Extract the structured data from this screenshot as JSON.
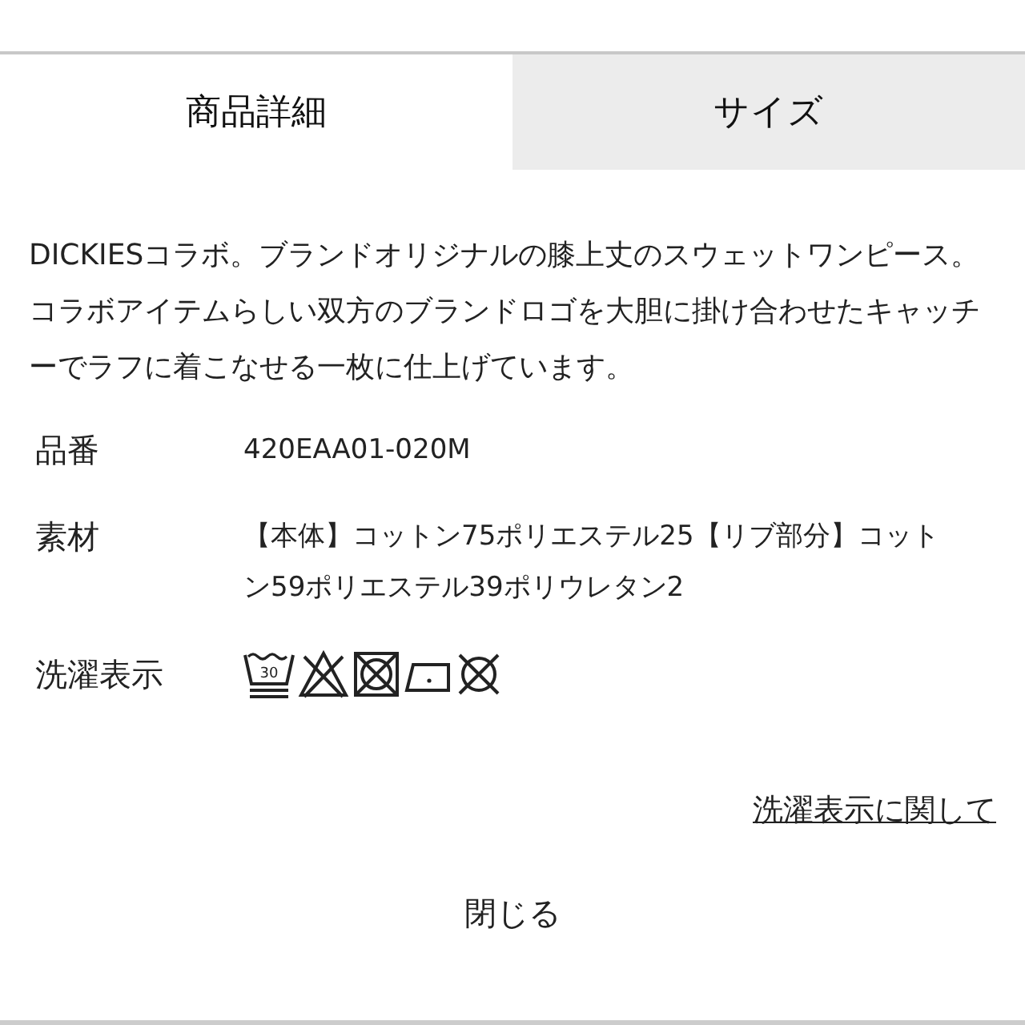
{
  "tabs": [
    {
      "label": "商品詳細",
      "selected": true
    },
    {
      "label": "サイズ",
      "selected": false
    }
  ],
  "description": "DICKIESコラボ。ブランドオリジナルの膝上丈のスウェットワンピース。コラボアイテムらしい双方のブランドロゴを大胆に掛け合わせたキャッチーでラフに着こなせる一枚に仕上げています。",
  "specs": [
    {
      "kind": "text",
      "label": "品番",
      "value": "420EAA01-020M"
    },
    {
      "kind": "text",
      "label": "素材",
      "value": "【本体】コットン75ポリエステル25【リブ部分】コットン59ポリエステル39ポリウレタン2"
    },
    {
      "kind": "care",
      "label": "洗濯表示",
      "care_symbols": [
        {
          "kind": "wash",
          "temperature": "30"
        },
        {
          "kind": "no-bleach"
        },
        {
          "kind": "no-tumble-dry"
        },
        {
          "kind": "iron"
        },
        {
          "kind": "no-dry-clean"
        }
      ]
    }
  ],
  "care_link": "洗濯表示に関して",
  "close_button": "閉じる"
}
